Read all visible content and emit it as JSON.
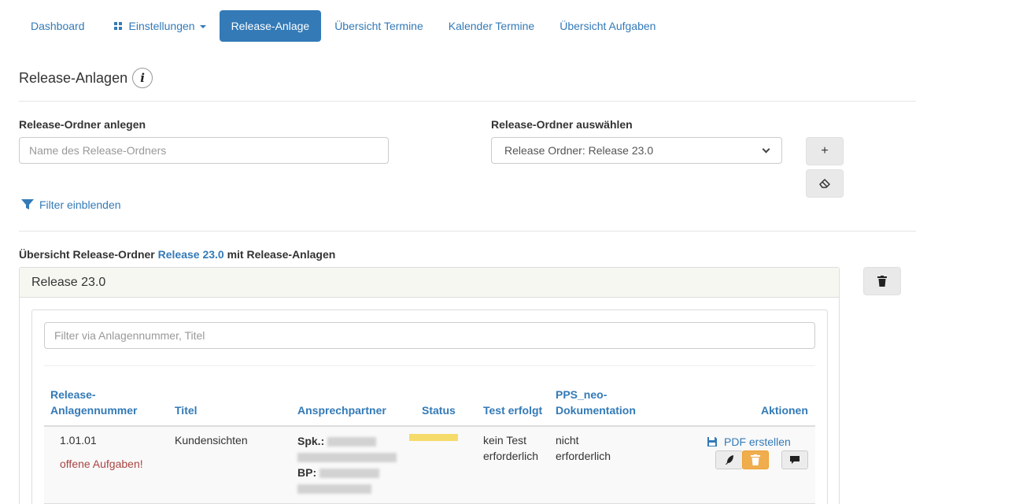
{
  "nav": {
    "items": [
      {
        "label": "Dashboard"
      },
      {
        "label": "Einstellungen"
      },
      {
        "label": "Release-Anlage"
      },
      {
        "label": "Übersicht Termine"
      },
      {
        "label": "Kalender Termine"
      },
      {
        "label": "Übersicht Aufgaben"
      }
    ],
    "active_index": 2
  },
  "page": {
    "title": "Release-Anlagen",
    "info_glyph": "i"
  },
  "form": {
    "create_label": "Release-Ordner anlegen",
    "create_placeholder": "Name des Release-Ordners",
    "select_label": "Release-Ordner auswählen",
    "selected_value": "Release Ordner: Release 23.0",
    "add_button_label": "+"
  },
  "filter_toggle": "Filter einblenden",
  "overview": {
    "prefix": "Übersicht Release-Ordner",
    "folder_name": "Release 23.0",
    "suffix": "mit Release-Anlagen"
  },
  "panel": {
    "title": "Release 23.0",
    "filter_placeholder": "Filter via Anlagennummer, Titel"
  },
  "table": {
    "columns": [
      {
        "line1": "Release-",
        "line2": "Anlagennummer"
      },
      {
        "line1": "",
        "line2": "Titel"
      },
      {
        "line1": "",
        "line2": "Ansprechpartner"
      },
      {
        "line1": "",
        "line2": "Status"
      },
      {
        "line1": "",
        "line2": "Test erfolgt"
      },
      {
        "line1": "PPS_neo-",
        "line2": "Dokumentation"
      },
      {
        "line1": "",
        "line2": "Aktionen"
      }
    ],
    "rows": [
      {
        "number": "1.01.01",
        "warning": "offene Aufgaben!",
        "title": "Kundensichten",
        "contact_spk_label": "Spk.:",
        "contact_bp_label": "BP:",
        "status_color": "#f5dc6a",
        "test_line1": "kein Test",
        "test_line2": "erforderlich",
        "doc_line1": "nicht",
        "doc_line2": "erforderlich",
        "pdf_label": "PDF erstellen"
      }
    ]
  },
  "colors": {
    "primary": "#337ab7",
    "warning": "#f0ad4e",
    "danger_text": "#a94442"
  }
}
